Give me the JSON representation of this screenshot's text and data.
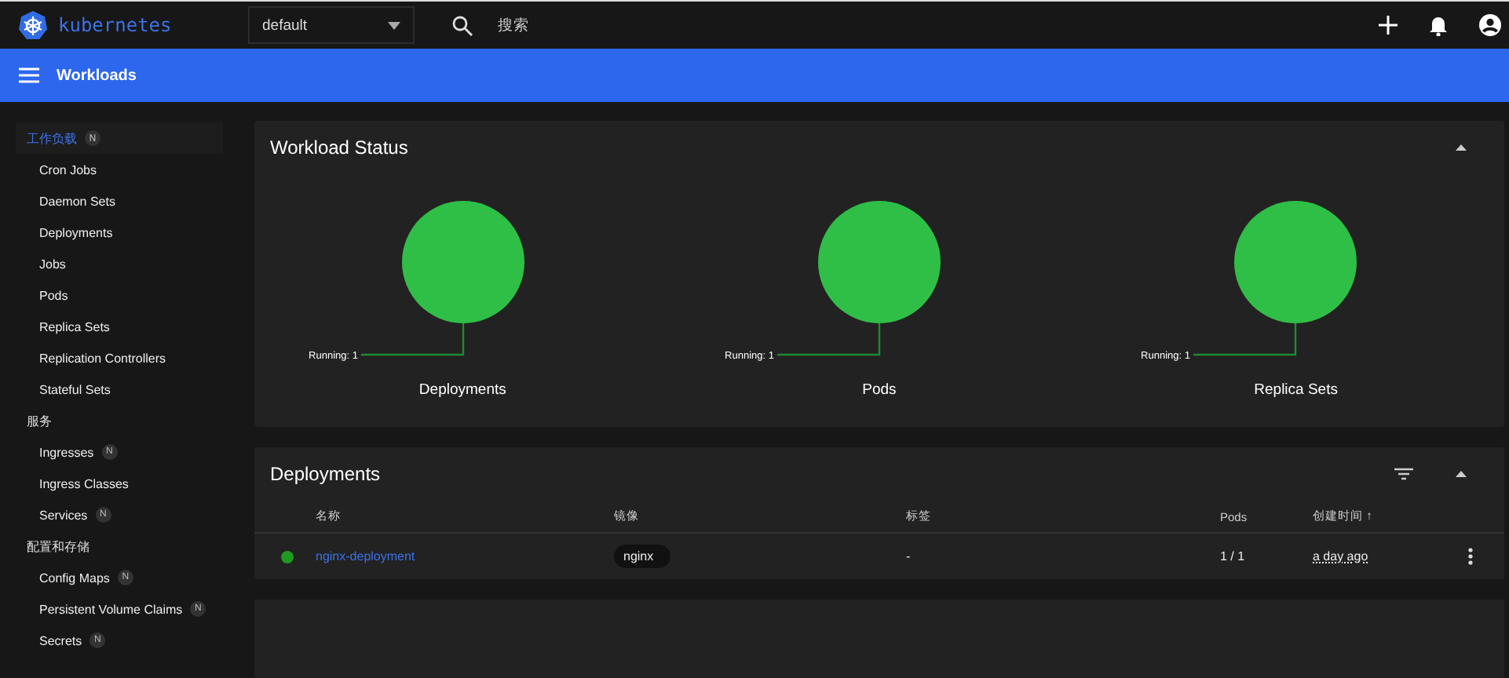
{
  "topbar": {
    "logo": "kubernetes",
    "namespace": "default",
    "search_placeholder": "搜索"
  },
  "toolbar": {
    "title": "Workloads"
  },
  "sidebar": {
    "sections": [
      {
        "title": "工作负载",
        "badge": "N",
        "selected": true,
        "items": [
          {
            "label": "Cron Jobs"
          },
          {
            "label": "Daemon Sets"
          },
          {
            "label": "Deployments"
          },
          {
            "label": "Jobs"
          },
          {
            "label": "Pods"
          },
          {
            "label": "Replica Sets"
          },
          {
            "label": "Replication Controllers"
          },
          {
            "label": "Stateful Sets"
          }
        ]
      },
      {
        "title": "服务",
        "selected": false,
        "items": [
          {
            "label": "Ingresses",
            "badge": "N"
          },
          {
            "label": "Ingress Classes"
          },
          {
            "label": "Services",
            "badge": "N"
          }
        ]
      },
      {
        "title": "配置和存储",
        "selected": false,
        "items": [
          {
            "label": "Config Maps",
            "badge": "N"
          },
          {
            "label": "Persistent Volume Claims",
            "badge": "N"
          },
          {
            "label": "Secrets",
            "badge": "N"
          }
        ]
      }
    ]
  },
  "workload_status": {
    "title": "Workload Status",
    "charts": [
      {
        "title": "Deployments",
        "label": "Running: 1"
      },
      {
        "title": "Pods",
        "label": "Running: 1"
      },
      {
        "title": "Replica Sets",
        "label": "Running: 1"
      }
    ]
  },
  "deployments": {
    "title": "Deployments",
    "columns": [
      "名称",
      "镜像",
      "标签",
      "Pods",
      "创建时间 ↑"
    ],
    "rows": [
      {
        "color": "#1f9a1f",
        "name": "nginx-deployment",
        "image": "nginx",
        "labels": "-",
        "pods": "1 / 1",
        "created": "a day ago"
      }
    ]
  }
}
